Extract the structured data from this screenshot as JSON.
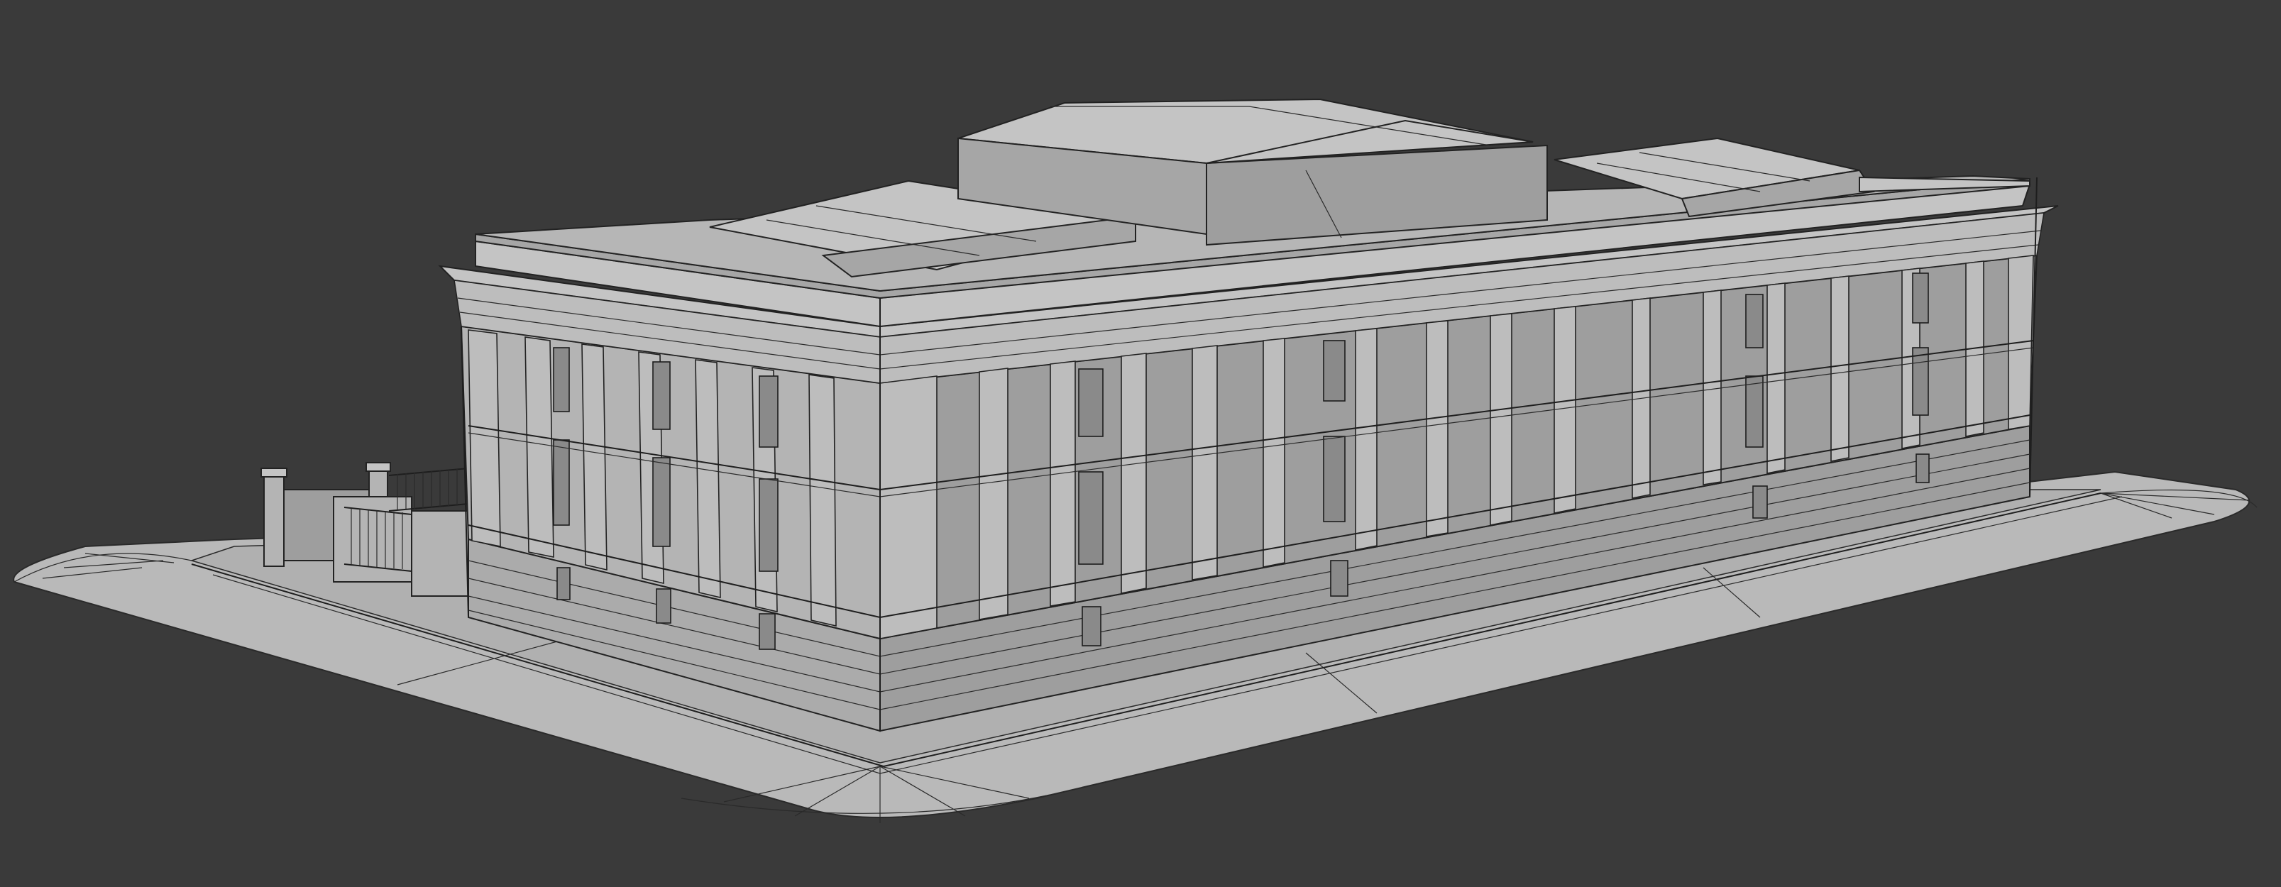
{
  "viewport": {
    "background_color": "#3a3a3a",
    "shading": "clay-wireframe",
    "subject": "building-3d-model"
  },
  "colors": {
    "model_light": "#c4c4c4",
    "model_mid": "#b4b4b4",
    "model_dark": "#9e9e9e",
    "wire": "#1e1e1e"
  }
}
